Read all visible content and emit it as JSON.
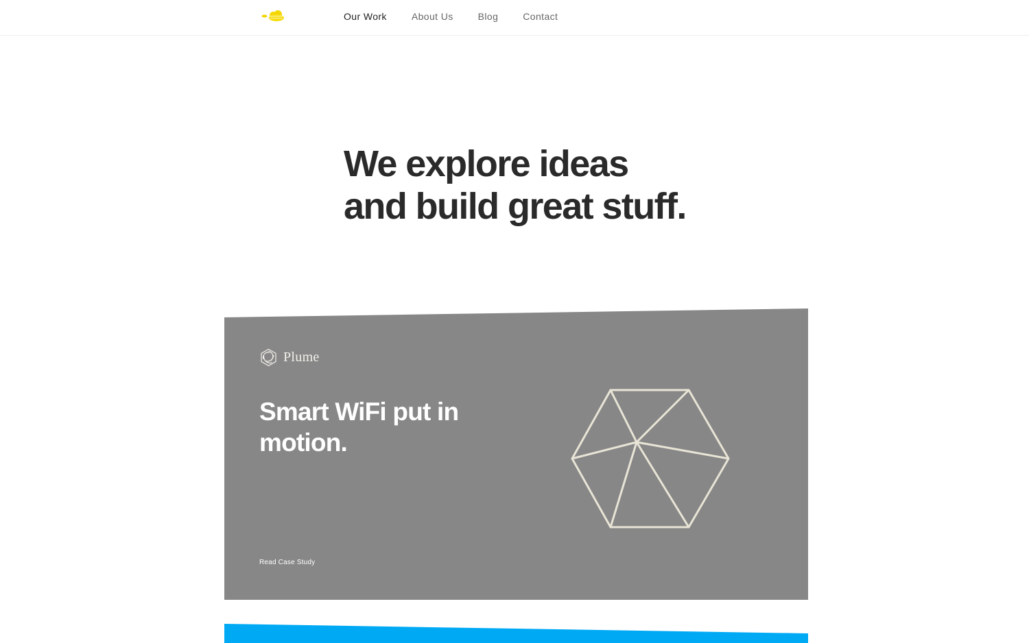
{
  "nav": {
    "items": [
      {
        "label": "Our Work",
        "active": true
      },
      {
        "label": "About Us",
        "active": false
      },
      {
        "label": "Blog",
        "active": false
      },
      {
        "label": "Contact",
        "active": false
      }
    ]
  },
  "hero": {
    "line1": "We explore ideas",
    "line2": "and build great stuff."
  },
  "case_study": {
    "brand": "Plume",
    "title": "Smart WiFi put in motion.",
    "link": "Read Case Study",
    "background_color": "#878787",
    "illustration_color": "#e8e4d6"
  },
  "next_case_color": "#00a9f4",
  "logo_color": "#f5d700"
}
